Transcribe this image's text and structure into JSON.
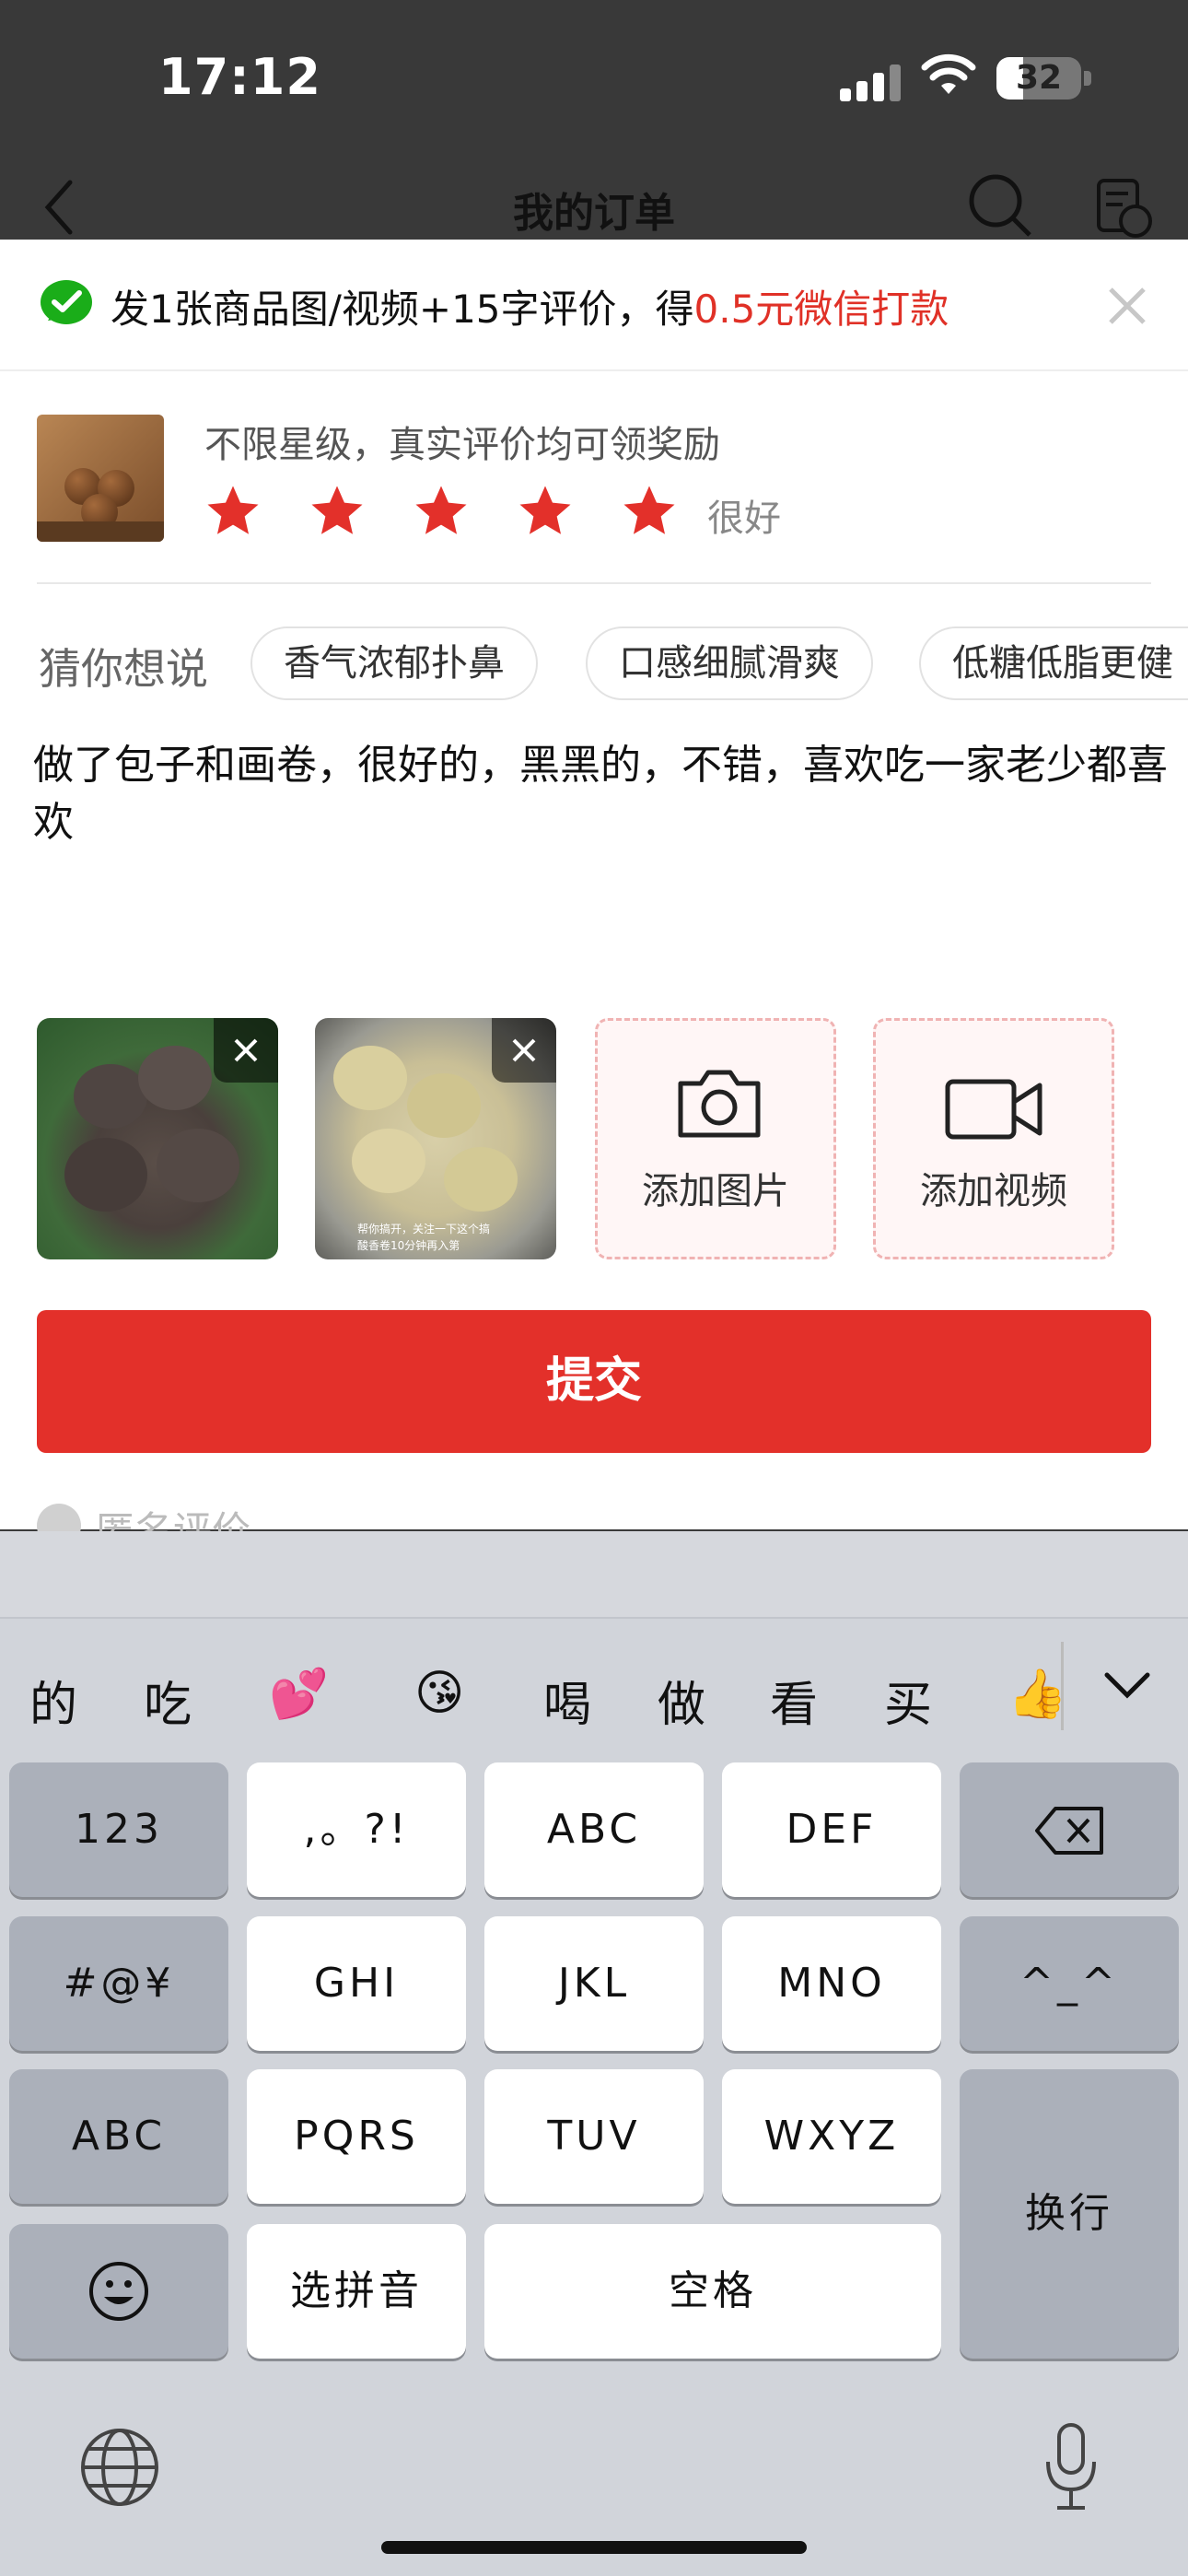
{
  "status_bar": {
    "time": "17:12",
    "battery": "32",
    "battery_level": 0.32
  },
  "nav": {
    "title": "我的订单"
  },
  "banner": {
    "text_prefix": "发1张商品图/视频+15字评价，得",
    "text_reward": "0.5元微信打款"
  },
  "product": {
    "reward_text": "不限星级，真实评价均可领奖励",
    "rating_stars": 5,
    "rating_label": "很好"
  },
  "guess": {
    "label": "猜你想说",
    "chips": [
      "香气浓郁扑鼻",
      "口感细腻滑爽",
      "低糖低脂更健"
    ]
  },
  "review": {
    "text": "做了包子和画卷，很好的，黑黑的，不错，喜欢吃一家老少都喜欢"
  },
  "media": {
    "add_photo_label": "添加图片",
    "add_video_label": "添加视频",
    "photo2_caption": "帮你搞开，关注一下这个搞酸香卷10分钟再入第"
  },
  "submit": {
    "label": "提交"
  },
  "anonymous": {
    "label": "匿名评价"
  },
  "keyboard": {
    "candidates": [
      "的",
      "吃",
      "💕",
      "😘",
      "喝",
      "做",
      "看",
      "买",
      "👍"
    ],
    "keys": {
      "k123": "123",
      "punct": ",。?!",
      "abc2": "ABC",
      "def": "DEF",
      "sym": "#@¥",
      "ghi": "GHI",
      "jkl": "JKL",
      "mno": "MNO",
      "face": "^_^",
      "abc": "ABC",
      "pqrs": "PQRS",
      "tuv": "TUV",
      "wxyz": "WXYZ",
      "enter": "换行",
      "pinyin": "选拼音",
      "space": "空格"
    }
  },
  "colors": {
    "accent": "#e3302a",
    "wechat_green": "#1aad19",
    "keyboard_bg": "#d1d4da"
  }
}
